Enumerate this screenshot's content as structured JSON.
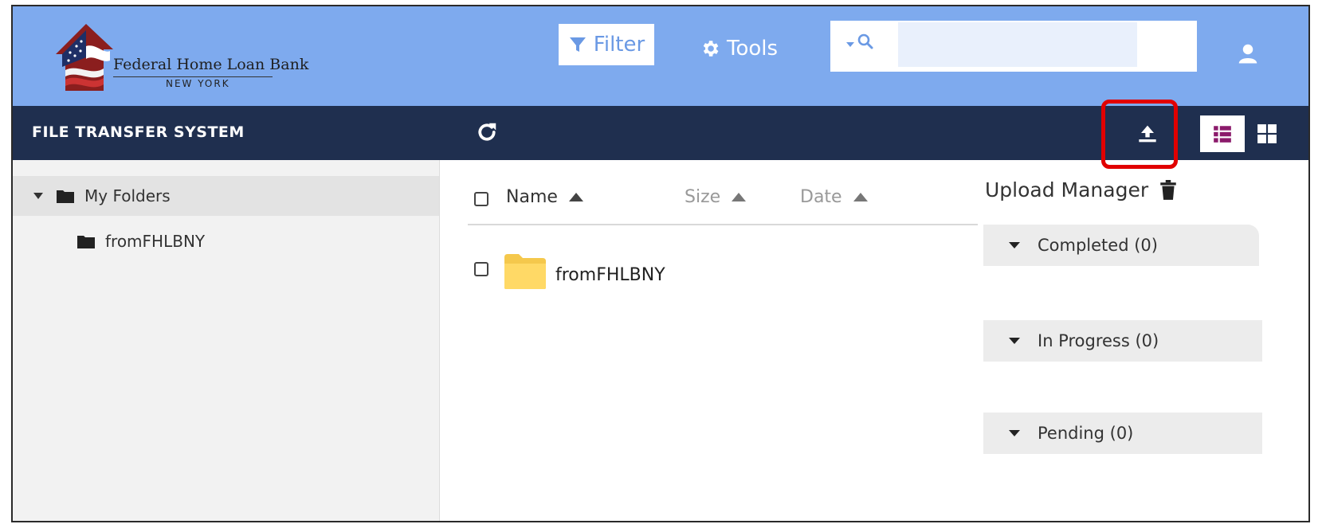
{
  "header": {
    "logo_line1": "Federal Home Loan Bank",
    "logo_line2": "NEW YORK",
    "filter_label": "Filter",
    "tools_label": "Tools",
    "search_value": ""
  },
  "navbar": {
    "title": "FILE TRANSFER SYSTEM"
  },
  "sidebar": {
    "root_label": "My Folders",
    "children": [
      "fromFHLBNY"
    ]
  },
  "file_list": {
    "columns": [
      "Name",
      "Size",
      "Date"
    ],
    "rows": [
      {
        "name": "fromFHLBNY",
        "type": "folder"
      }
    ]
  },
  "upload_manager": {
    "title": "Upload Manager",
    "sections": [
      "Completed (0)",
      "In Progress (0)",
      "Pending (0)"
    ]
  },
  "colors": {
    "header_bg": "#7eaaee",
    "navbar_bg": "#1f2f4f",
    "highlight": "#e10000",
    "folder_yellow": "#ffd966",
    "list_view_icon": "#8b1a6b"
  },
  "icons": [
    "flag-house-logo",
    "filter-icon",
    "gear-icon",
    "search-icon",
    "user-icon",
    "refresh-icon",
    "upload-icon",
    "list-view-icon",
    "grid-view-icon",
    "folder-icon",
    "trash-icon"
  ]
}
